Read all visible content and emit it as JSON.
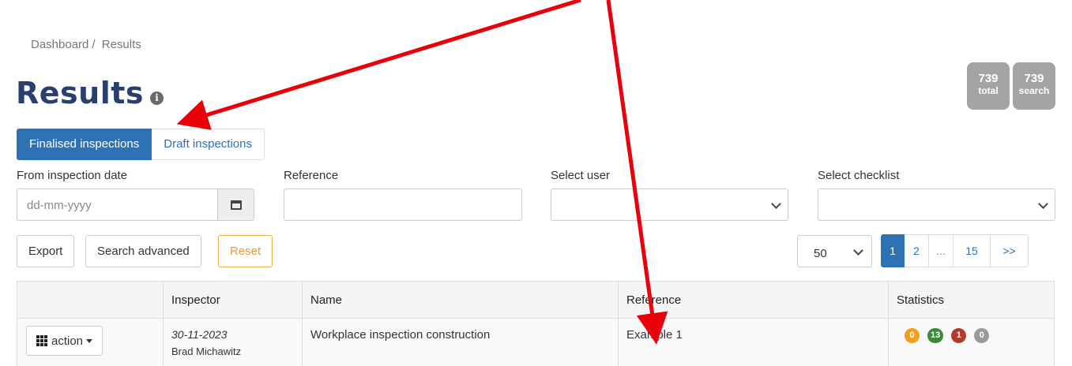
{
  "breadcrumb": {
    "home": "Dashboard",
    "separator": "/",
    "current": "Results"
  },
  "page": {
    "title": "Results",
    "info_icon": "info-circle-icon"
  },
  "counts": [
    {
      "value": "739",
      "label": "total"
    },
    {
      "value": "739",
      "label": "search"
    }
  ],
  "tabs": {
    "finalised": "Finalised inspections",
    "draft": "Draft inspections"
  },
  "filters": {
    "from_date_label": "From inspection date",
    "from_date_placeholder": "dd-mm-yyyy",
    "reference_label": "Reference",
    "user_label": "Select user",
    "checklist_label": "Select checklist"
  },
  "buttons": {
    "export": "Export",
    "search_advanced": "Search advanced",
    "reset": "Reset"
  },
  "per_page": "50",
  "pagination": [
    "1",
    "2",
    "...",
    "15",
    ">>"
  ],
  "table": {
    "headers": [
      "",
      "Inspector",
      "Name",
      "Reference",
      "Statistics"
    ],
    "rows": [
      {
        "action": "action",
        "date": "30-11-2023",
        "inspector": "Brad Michawitz",
        "name": "Workplace inspection construction",
        "reference": "Example 1",
        "stats": [
          {
            "value": "0",
            "color": "#f0a01c"
          },
          {
            "value": "13",
            "color": "#3d8a3d"
          },
          {
            "value": "1",
            "color": "#b03a2e"
          },
          {
            "value": "0",
            "color": "#9a9a9a"
          }
        ]
      }
    ]
  },
  "annotation_color": "#e8000b"
}
